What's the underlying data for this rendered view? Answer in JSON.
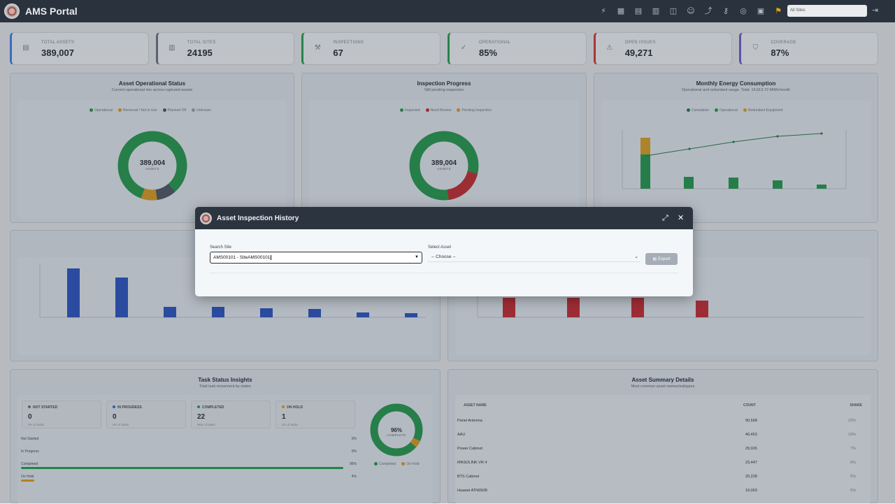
{
  "app": {
    "title": "AMS Portal",
    "site_select": "All Sites"
  },
  "nav_icons": [
    "bolt-icon",
    "grid-icon",
    "clipboard-icon",
    "map-icon",
    "box-icon",
    "user-icon",
    "route-icon",
    "key-icon",
    "globe-icon",
    "calendar-icon",
    "flag-icon"
  ],
  "kpis": [
    {
      "label": "TOTAL ASSETS",
      "value": "389,007",
      "icon": "server-icon",
      "color": "#3b82f6"
    },
    {
      "label": "TOTAL SITES",
      "value": "24195",
      "icon": "building-icon",
      "color": "#6b7280"
    },
    {
      "label": "INSPECTIONS",
      "value": "67",
      "icon": "wrench-icon",
      "color": "#22a04b"
    },
    {
      "label": "OPERATIONAL",
      "value": "85%",
      "icon": "check-circle-icon",
      "color": "#22a04b"
    },
    {
      "label": "OPEN ISSUES",
      "value": "49,271",
      "icon": "warning-icon",
      "color": "#d33"
    },
    {
      "label": "COVERAGE",
      "value": "87%",
      "icon": "shield-icon",
      "color": "#6d5bd0"
    }
  ],
  "cards": {
    "asset_status": {
      "title": "Asset Operational Status",
      "subtitle": "Current operational mix across captured assets",
      "legend": [
        "Operational",
        "Removed / Not in Use",
        "Planned Off",
        "Unknown"
      ],
      "center_value": "389,004",
      "center_label": "ASSETS"
    },
    "inspection": {
      "title": "Inspection Progress",
      "subtitle": "Still pending inspection",
      "legend": [
        "Inspected",
        "Need Review",
        "Pending Inspection"
      ],
      "center_value": "389,004",
      "center_label": "ASSETS"
    },
    "energy": {
      "title": "Monthly Energy Consumption",
      "subtitle": "Operational and redundant usage. Total: 14,913.72 MWh/month",
      "legend": [
        "Cumulative",
        "Operational",
        "Redundant Equipment"
      ]
    },
    "task": {
      "title": "Task Status Insights",
      "subtitle": "Total task movement by states",
      "donut_value": "96%",
      "donut_label": "COMPLETE",
      "donut_legend": [
        "Completed",
        "On Hold"
      ]
    },
    "summary": {
      "title": "Asset Summary Details",
      "subtitle": "Most common asset names/subtypes"
    }
  },
  "task_tiles": [
    {
      "label": "NOT STARTED",
      "value": "0",
      "sub": "0% of tasks",
      "color": "#6b7280"
    },
    {
      "label": "IN PROGRESS",
      "value": "0",
      "sub": "0% of tasks",
      "color": "#2563eb"
    },
    {
      "label": "COMPLETED",
      "value": "22",
      "sub": "96% of tasks",
      "color": "#16a34a"
    },
    {
      "label": "ON HOLD",
      "value": "1",
      "sub": "4% of tasks",
      "color": "#e5a00d"
    }
  ],
  "task_bars": [
    {
      "label": "Not Started",
      "pct": "0%",
      "fill": 0,
      "color": "#999"
    },
    {
      "label": "In Progress",
      "pct": "0%",
      "fill": 0,
      "color": "#2563eb"
    },
    {
      "label": "Completed",
      "pct": "96%",
      "fill": 0.96,
      "color": "#16a34a"
    },
    {
      "label": "On Hold",
      "pct": "4%",
      "fill": 0.04,
      "color": "#e5a00d"
    }
  ],
  "summary_table": {
    "headers": [
      "ASSET NAME",
      "COUNT",
      "SHARE"
    ],
    "rows": [
      [
        "Panel Antenna",
        "90,568",
        "23%"
      ],
      [
        "AAU",
        "40,453",
        "10%"
      ],
      [
        "Power Cabinet",
        "29,026",
        "7%"
      ],
      [
        "IPASOLINK VR 4",
        "23,447",
        "6%"
      ],
      [
        "BTS Cabinet",
        "20,228",
        "5%"
      ],
      [
        "Huawei ATN950B",
        "19,063",
        "5%"
      ]
    ]
  },
  "modal": {
    "title": "Asset Inspection History",
    "site_label": "Search Site",
    "site_value": "AMS00101 - SiteAMS00101",
    "asset_label": "Select Asset",
    "asset_value": "-- Choose --",
    "export_label": "Export"
  }
}
